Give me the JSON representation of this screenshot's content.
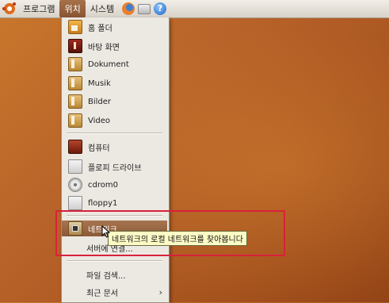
{
  "panel": {
    "menus": [
      "프로그램",
      "위치",
      "시스템"
    ],
    "active_menu": "위치",
    "apps": [
      "firefox-icon",
      "mail-icon",
      "help-icon"
    ],
    "help_glyph": "?"
  },
  "places_menu": {
    "items": [
      {
        "label": "홈 폴더",
        "icon": "home-folder-icon"
      },
      {
        "label": "바탕 화면",
        "icon": "desktop-folder-icon"
      },
      {
        "label": "Dokument",
        "icon": "folder-icon"
      },
      {
        "label": "Musik",
        "icon": "music-folder-icon"
      },
      {
        "label": "Bilder",
        "icon": "pictures-folder-icon"
      },
      {
        "label": "Video",
        "icon": "video-folder-icon"
      },
      {
        "label": "컴퓨터",
        "icon": "computer-icon"
      },
      {
        "label": "플로피 드라이브",
        "icon": "floppy-drive-icon"
      },
      {
        "label": "cdrom0",
        "icon": "cdrom-icon"
      },
      {
        "label": "floppy1",
        "icon": "floppy-icon"
      },
      {
        "label": "네트워크",
        "icon": "network-icon",
        "highlighted": true
      },
      {
        "label": "서버에 연결...",
        "icon": ""
      },
      {
        "label": "파일 검색...",
        "icon": ""
      },
      {
        "label": "최근 문서",
        "icon": "",
        "submenu": true
      }
    ],
    "submenu_glyph": "›"
  },
  "tooltip": {
    "text": "네트워크의 로컬 네트워크를 찾아봅니다"
  },
  "colors": {
    "highlight": "#8b5a38",
    "annotation": "#d8213a",
    "tooltip_bg": "#fefcc6"
  }
}
